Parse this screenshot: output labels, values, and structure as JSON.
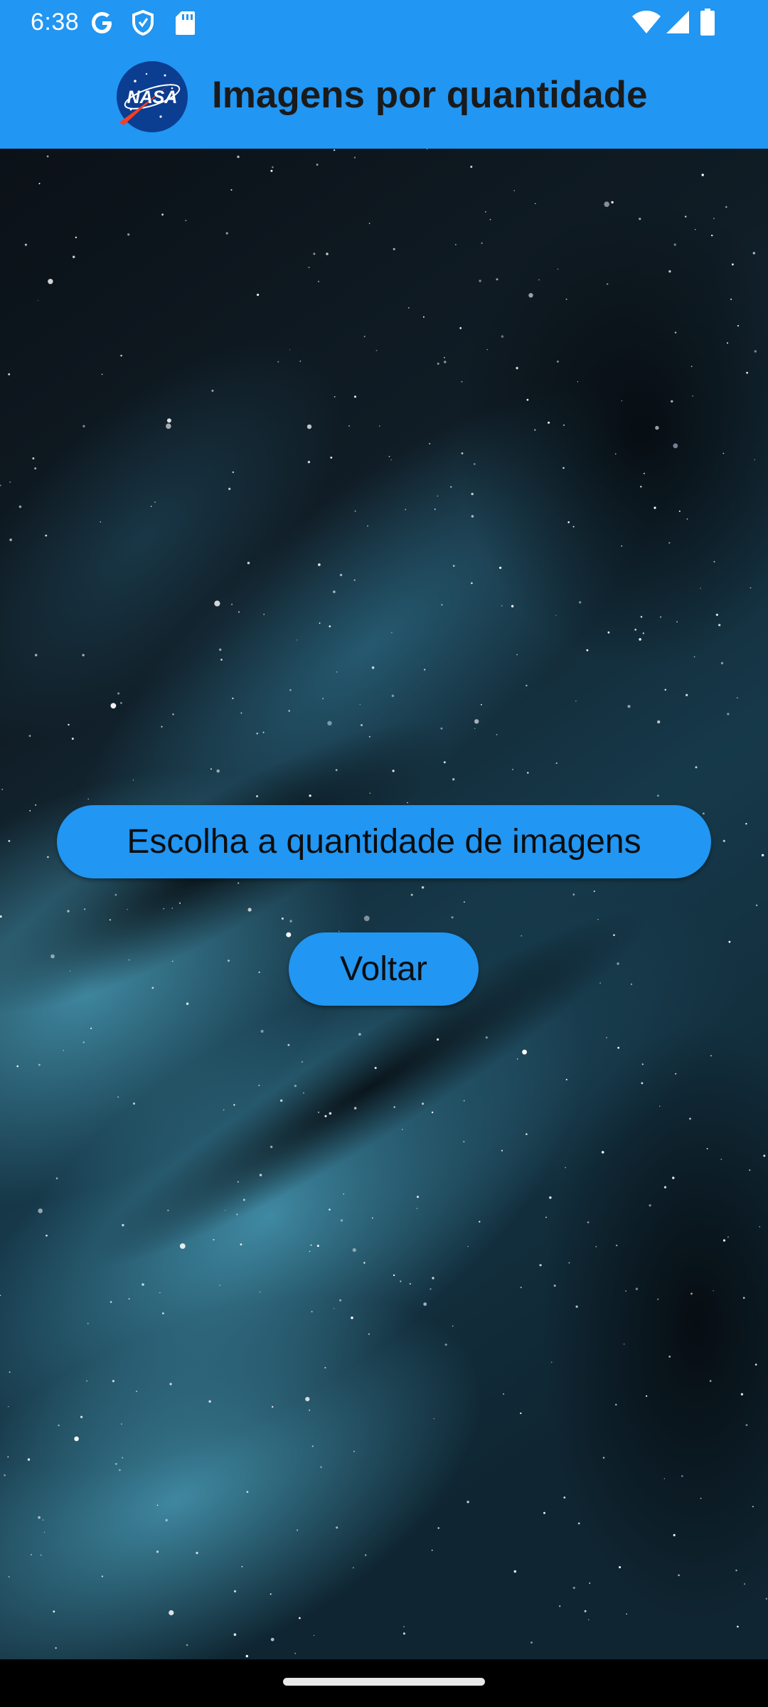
{
  "status_bar": {
    "time": "6:38",
    "icons": [
      "google-g-icon",
      "shield-icon",
      "sd-card-icon",
      "wifi-icon",
      "cell-signal-icon",
      "battery-icon"
    ]
  },
  "app_bar": {
    "logo": "nasa-logo",
    "logo_text": "NASA",
    "title": "Imagens por quantidade",
    "background_color": "#2196F3"
  },
  "main": {
    "background": "starfield-nebula",
    "choose_button_label": "Escolha a quantidade de imagens",
    "back_button_label": "Voltar",
    "button_color": "#2196F3"
  },
  "nav_bar": {
    "home_indicator": "home-indicator"
  }
}
